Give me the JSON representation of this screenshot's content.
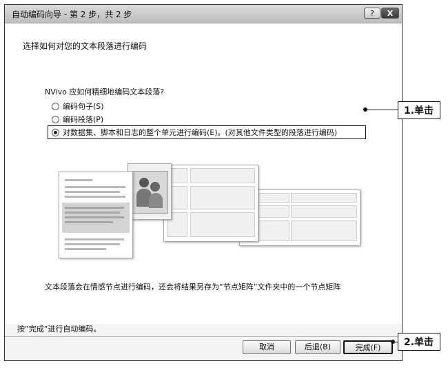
{
  "window": {
    "title": "自动编码向导 - 第 2 步，共 2 步",
    "help_label": "?",
    "close_label": "X"
  },
  "main": {
    "heading": "选择如何对您的文本段落进行编码",
    "question": "NVivo 应如何精细地编码文本段落?",
    "options": [
      {
        "label": "编码句子(S)",
        "selected": false
      },
      {
        "label": "编码段落(P)",
        "selected": false
      },
      {
        "label": "对数据集、脚本和日志的整个单元进行编码(E)。(对其他文件类型的段落进行编码)",
        "selected": true
      }
    ],
    "note": "文本段落会在情感节点进行编码，还会将结果另存为“节点矩阵”文件夹中的一个节点矩阵"
  },
  "footer": {
    "hint": "按“完成”进行自动编码。",
    "cancel_label": "取消",
    "back_label": "后退(B)",
    "finish_label": "完成(F)"
  },
  "annotations": {
    "callout_1": "1.单击",
    "callout_2": "2.单击"
  }
}
